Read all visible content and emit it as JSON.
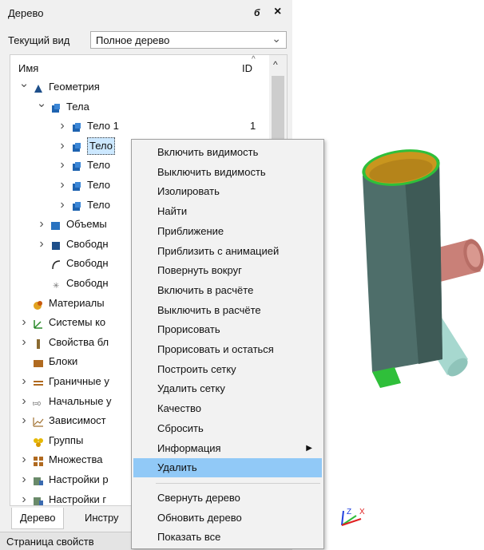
{
  "panel": {
    "title": "Дерево",
    "pin_icon": "pin-icon",
    "close_icon": "close-icon",
    "view_label": "Текущий вид",
    "view_value": "Полное дерево"
  },
  "tree": {
    "col_name": "Имя",
    "col_id": "ID",
    "rows": [
      {
        "label": "Геометрия",
        "expander": "open",
        "icon": "geometry-icon",
        "id": ""
      },
      {
        "label": "Тела",
        "expander": "open",
        "icon": "bodies-icon",
        "id": ""
      },
      {
        "label": "Тело 1",
        "expander": "closed",
        "icon": "body-icon",
        "id": "1"
      },
      {
        "label": "Тело",
        "expander": "closed",
        "icon": "body-icon",
        "id": ""
      },
      {
        "label": "Тело",
        "expander": "closed",
        "icon": "body-icon",
        "id": ""
      },
      {
        "label": "Тело",
        "expander": "closed",
        "icon": "body-icon",
        "id": ""
      },
      {
        "label": "Тело",
        "expander": "closed",
        "icon": "body-icon",
        "id": ""
      },
      {
        "label": "Объемы",
        "expander": "closed",
        "icon": "volumes-icon",
        "id": ""
      },
      {
        "label": "Свободн",
        "expander": "closed",
        "icon": "free-faces-icon",
        "id": ""
      },
      {
        "label": "Свободн",
        "expander": "none",
        "icon": "free-edges-icon",
        "id": ""
      },
      {
        "label": "Свободн",
        "expander": "none",
        "icon": "free-points-icon",
        "id": ""
      },
      {
        "label": "Материалы",
        "expander": "none",
        "icon": "materials-icon",
        "id": ""
      },
      {
        "label": "Системы ко",
        "expander": "closed",
        "icon": "coordinate-systems-icon",
        "id": ""
      },
      {
        "label": "Свойства бл",
        "expander": "closed",
        "icon": "block-properties-icon",
        "id": ""
      },
      {
        "label": "Блоки",
        "expander": "none",
        "icon": "blocks-icon",
        "id": ""
      },
      {
        "label": "Граничные у",
        "expander": "closed",
        "icon": "boundary-conditions-icon",
        "id": ""
      },
      {
        "label": "Начальные у",
        "expander": "closed",
        "icon": "initial-conditions-icon",
        "id": ""
      },
      {
        "label": "Зависимост",
        "expander": "closed",
        "icon": "dependencies-icon",
        "id": ""
      },
      {
        "label": "Группы",
        "expander": "none",
        "icon": "groups-icon",
        "id": ""
      },
      {
        "label": "Множества",
        "expander": "closed",
        "icon": "sets-icon",
        "id": ""
      },
      {
        "label": "Настройки р",
        "expander": "closed",
        "icon": "settings-icon",
        "id": ""
      },
      {
        "label": "Настройки г",
        "expander": "closed",
        "icon": "settings-icon",
        "id": ""
      }
    ]
  },
  "tabs": [
    "Дерево",
    "Инстру"
  ],
  "properties_title": "Страница свойств",
  "context_menu": {
    "items": [
      {
        "label": "Включить видимость"
      },
      {
        "label": "Выключить видимость"
      },
      {
        "label": "Изолировать"
      },
      {
        "label": "Найти"
      },
      {
        "label": "Приближение"
      },
      {
        "label": "Приблизить с анимацией"
      },
      {
        "label": "Повернуть вокруг"
      },
      {
        "label": "Включить в расчёте"
      },
      {
        "label": "Выключить в расчёте"
      },
      {
        "label": "Прорисовать"
      },
      {
        "label": "Прорисовать и остаться"
      },
      {
        "label": "Построить сетку"
      },
      {
        "label": "Удалить сетку"
      },
      {
        "label": "Качество"
      },
      {
        "label": "Сбросить"
      },
      {
        "label": "Информация",
        "submenu": true
      },
      {
        "label": "Удалить",
        "highlighted": true
      },
      {
        "label": "Свернуть дерево"
      },
      {
        "label": "Обновить дерево"
      },
      {
        "label": "Показать все"
      }
    ]
  },
  "viewport": {
    "axes_labels": [
      "Z",
      "X"
    ],
    "colors": {
      "pipe_main": "#4e6e6a",
      "pipe_inner": "#c9961e",
      "pipe_small": "#a7d8cf",
      "pipe_red": "#c98078",
      "rim_green": "#2fbf3a",
      "selection": "#91c9f7"
    }
  }
}
